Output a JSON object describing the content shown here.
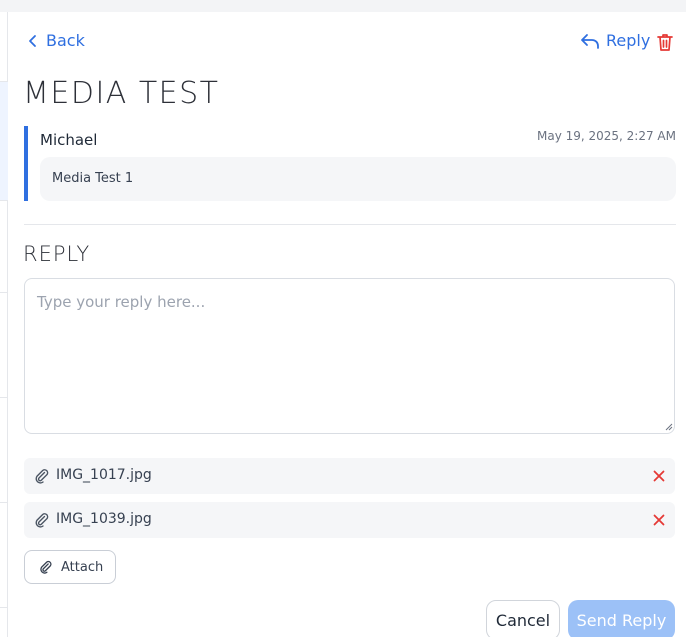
{
  "header": {
    "back_label": "Back",
    "reply_label": "Reply"
  },
  "thread": {
    "title": "MEDIA TEST"
  },
  "message": {
    "author": "Michael",
    "timestamp": "May 19, 2025, 2:27 AM",
    "body": "Media Test 1"
  },
  "reply": {
    "heading": "REPLY",
    "placeholder": "Type your reply here...",
    "value": ""
  },
  "attachments": [
    {
      "filename": "IMG_1017.jpg"
    },
    {
      "filename": "IMG_1039.jpg"
    }
  ],
  "actions": {
    "attach_label": "Attach",
    "cancel_label": "Cancel",
    "send_label": "Send Reply"
  },
  "colors": {
    "accent": "#2f6fe0",
    "danger": "#e53935",
    "send_disabled": "#9cc1f7"
  }
}
